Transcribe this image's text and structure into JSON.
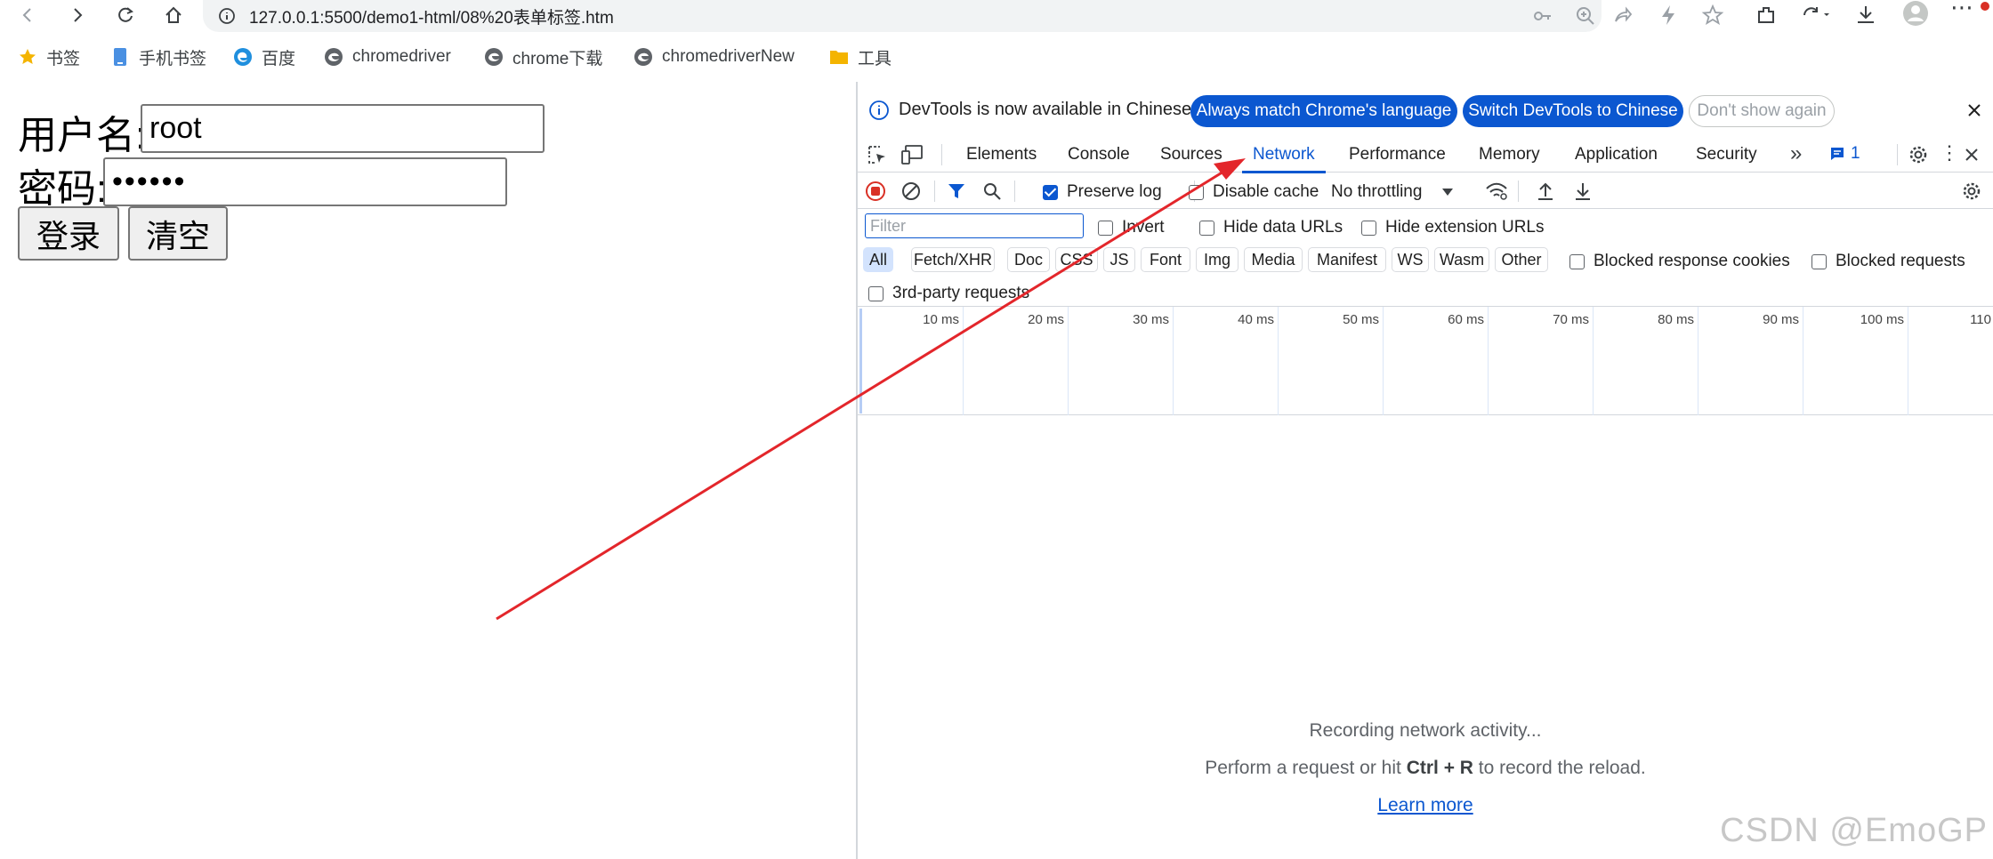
{
  "browser": {
    "url": "127.0.0.1:5500/demo1-html/08%20表单标签.htm",
    "bookmarks": [
      {
        "label": "书签",
        "icon": "star-icon"
      },
      {
        "label": "手机书签",
        "icon": "phone-icon"
      },
      {
        "label": "百度",
        "icon": "edge-icon"
      },
      {
        "label": "chromedriver",
        "icon": "site-icon"
      },
      {
        "label": "chrome下载",
        "icon": "site-icon"
      },
      {
        "label": "chromedriverNew",
        "icon": "site-icon"
      },
      {
        "label": "工具",
        "icon": "folder-icon"
      }
    ]
  },
  "form": {
    "username_label": "用户名:",
    "username_value": "root",
    "password_label": "密码:",
    "password_value": "••••••",
    "login_label": "登录",
    "clear_label": "清空"
  },
  "devtools": {
    "infobar": {
      "message": "DevTools is now available in Chinese!",
      "match_btn": "Always match Chrome's language",
      "switch_btn": "Switch DevTools to Chinese",
      "dismiss_btn": "Don't show again"
    },
    "tabs": [
      "Elements",
      "Console",
      "Sources",
      "Network",
      "Performance",
      "Memory",
      "Application",
      "Security"
    ],
    "active_tab": "Network",
    "issues_count": "1",
    "toolbar": {
      "preserve_log": "Preserve log",
      "disable_cache": "Disable cache",
      "throttling": "No throttling"
    },
    "filter": {
      "placeholder": "Filter",
      "invert": "Invert",
      "hide_data_urls": "Hide data URLs",
      "hide_extension_urls": "Hide extension URLs"
    },
    "types": [
      "All",
      "Fetch/XHR",
      "Doc",
      "CSS",
      "JS",
      "Font",
      "Img",
      "Media",
      "Manifest",
      "WS",
      "Wasm",
      "Other"
    ],
    "blocked_response_cookies": "Blocked response cookies",
    "blocked_requests": "Blocked requests",
    "third_party": "3rd-party requests",
    "timeline_ticks": [
      "10 ms",
      "20 ms",
      "30 ms",
      "40 ms",
      "50 ms",
      "60 ms",
      "70 ms",
      "80 ms",
      "90 ms",
      "100 ms",
      "110"
    ],
    "empty_state": {
      "line1": "Recording network activity...",
      "line2_pre": "Perform a request or hit ",
      "line2_key": "Ctrl + R",
      "line2_post": " to record the reload.",
      "learn_more": "Learn more"
    }
  },
  "watermark": "CSDN @EmoGP",
  "colors": {
    "accent": "#0b57d0",
    "arrow": "#e3262b",
    "record": "#d93025"
  }
}
